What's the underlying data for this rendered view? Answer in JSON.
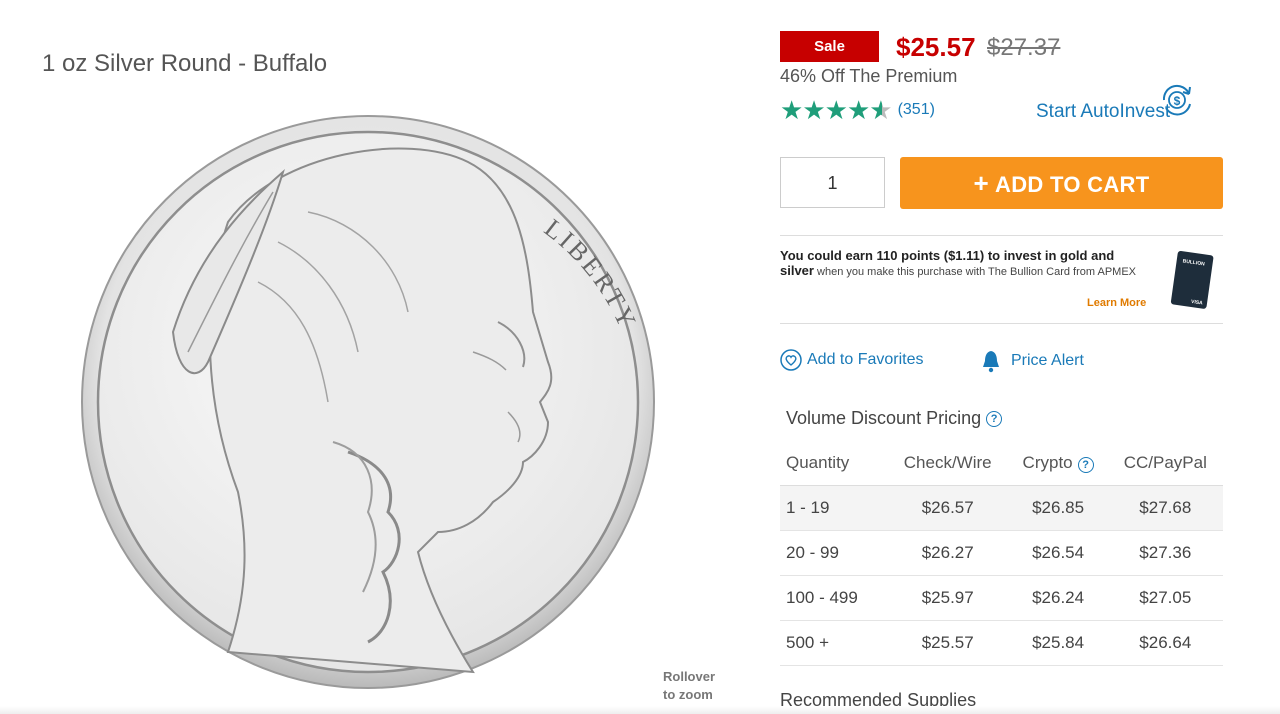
{
  "product": {
    "title": "1 oz Silver Round - Buffalo",
    "rollover_line1": "Rollover",
    "rollover_line2": "to zoom",
    "coin_legend": "LIBERTY"
  },
  "pricing": {
    "sale_label": "Sale",
    "price_now": "$25.57",
    "price_was": "$27.37",
    "premium_note": "46% Off The Premium"
  },
  "rating": {
    "value": 4.5,
    "max": 5,
    "count_text": "(351)"
  },
  "autoinvest": {
    "label": "Start AutoInvest"
  },
  "cart": {
    "quantity": "1",
    "add_label": "ADD TO CART",
    "plus": "+"
  },
  "promo": {
    "bold_text": "You could earn 110 points ($1.11) to invest in gold and silver",
    "rest_text": " when you make this purchase with The Bullion Card from APMEX",
    "learn_more": "Learn More",
    "card_brand": "BULLION",
    "card_network": "VISA"
  },
  "actions": {
    "favorites": "Add to Favorites",
    "price_alert": "Price Alert"
  },
  "volume_pricing": {
    "title": "Volume Discount Pricing",
    "help_glyph": "?",
    "headers": [
      "Quantity",
      "Check/Wire",
      "Crypto",
      "CC/PayPal"
    ],
    "rows": [
      [
        "1 - 19",
        "$26.57",
        "$26.85",
        "$27.68"
      ],
      [
        "20 - 99",
        "$26.27",
        "$26.54",
        "$27.36"
      ],
      [
        "100 - 499",
        "$25.97",
        "$26.24",
        "$27.05"
      ],
      [
        "500 +",
        "$25.57",
        "$25.84",
        "$26.64"
      ]
    ]
  },
  "recommended": {
    "title": "Recommended Supplies"
  },
  "colors": {
    "sale_red": "#c70000",
    "cart_orange": "#f7941d",
    "link_blue": "#1a7ab8",
    "star_green": "#1f9e7a"
  },
  "icons": [
    "heart-icon",
    "bell-icon",
    "autoinvest-cycle-icon",
    "help-icon",
    "star-icon"
  ]
}
